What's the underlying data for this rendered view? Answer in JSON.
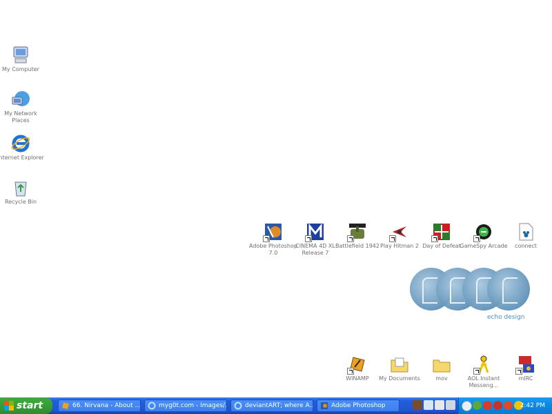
{
  "desktop": {
    "left_icons": [
      {
        "label": "My Computer",
        "icon": "my-computer-icon"
      },
      {
        "label": "My Network Places",
        "icon": "network-places-icon"
      },
      {
        "label": "Internet Explorer",
        "icon": "internet-explorer-icon"
      },
      {
        "label": "Recycle Bin",
        "icon": "recycle-bin-icon"
      }
    ],
    "middle_row": [
      {
        "label": "Adobe Photoshop 7.0",
        "icon": "photoshop-icon"
      },
      {
        "label": "CINEMA 4D XL Release 7",
        "icon": "cinema4d-icon"
      },
      {
        "label": "Battlefield 1942",
        "icon": "battlefield-icon"
      },
      {
        "label": "Play Hitman 2",
        "icon": "hitman-icon"
      },
      {
        "label": "Day of Defeat",
        "icon": "day-of-defeat-icon"
      },
      {
        "label": "GameSpy Arcade",
        "icon": "gamespy-icon"
      },
      {
        "label": "connect",
        "icon": "connect-icon"
      }
    ],
    "bottom_row": [
      {
        "label": "WINAMP",
        "icon": "winamp-icon"
      },
      {
        "label": "My Documents",
        "icon": "my-documents-icon"
      },
      {
        "label": "mov",
        "icon": "folder-icon"
      },
      {
        "label": "AOL Instant Messeng...",
        "icon": "aim-icon"
      },
      {
        "label": "mIRC",
        "icon": "mirc-icon"
      }
    ],
    "logo_caption": "echo design"
  },
  "taskbar": {
    "start_label": "start",
    "buttons": [
      {
        "label": "66. Nirvana - About ...",
        "icon": "winamp-icon"
      },
      {
        "label": "myg0t.com - Images/...",
        "icon": "internet-explorer-icon"
      },
      {
        "label": "deviantART; where A...",
        "icon": "internet-explorer-icon"
      },
      {
        "label": "Adobe Photoshop",
        "icon": "photoshop-icon"
      }
    ],
    "clock": "2:42 PM"
  },
  "colors": {
    "taskbar": "#245edb",
    "start": "#38a238",
    "tray": "#0c8be6",
    "label": "#6f6f6f",
    "logo": "#5c8fb6"
  }
}
